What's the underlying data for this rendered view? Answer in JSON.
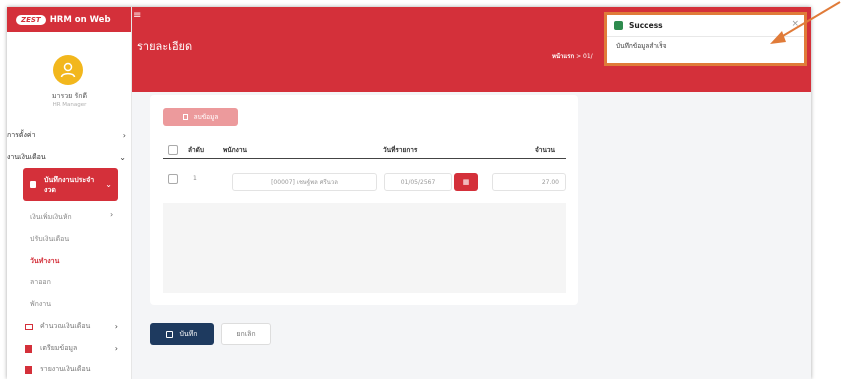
{
  "brand": {
    "logo": "ZEST",
    "title": "HRM on Web"
  },
  "user": {
    "name": "มารวย รักดี",
    "role": "HR Manager"
  },
  "sidebar": {
    "items": [
      {
        "label": "การตั้งค่า"
      },
      {
        "label": "งานเงินเดือน"
      }
    ],
    "active": {
      "label_line1": "บันทึกงานประจำ",
      "label_line2": "งวด"
    },
    "subitems": [
      {
        "label": "เงินเพิ่มเงินหัก"
      },
      {
        "label": "ปรับเงินเดือน"
      },
      {
        "label": "วันทำงาน"
      },
      {
        "label": "ลาออก"
      },
      {
        "label": "พักงาน"
      }
    ],
    "bottom": [
      {
        "label": "คำนวณเงินเดือน"
      },
      {
        "label": "เตรียมข้อมูล"
      },
      {
        "label": "รายงานเงินเดือน"
      }
    ]
  },
  "header": {
    "title": "รายละเอียด",
    "breadcrumb_home": "หน้าแรก",
    "breadcrumb_sep": ">",
    "breadcrumb_next": "01/"
  },
  "card": {
    "delete_label": "ลบข้อมูล",
    "columns": [
      "ลำดับ",
      "พนักงาน",
      "วันที่รายการ",
      "จำนวน"
    ],
    "row": {
      "index": "1",
      "employee": "[00007] เชษฐ์พล ศรีนวล",
      "date": "01/05/2567",
      "amount": "27.00"
    }
  },
  "actions": {
    "save": "บันทึก",
    "cancel": "ยกเลิก"
  },
  "toast": {
    "title": "Success",
    "message": "บันทึกข้อมูลสำเร็จ",
    "close": "×"
  },
  "colors": {
    "primary": "#d4303a",
    "navy": "#1e3a5f",
    "success": "#2e8b4e",
    "highlight": "#e07b39"
  }
}
